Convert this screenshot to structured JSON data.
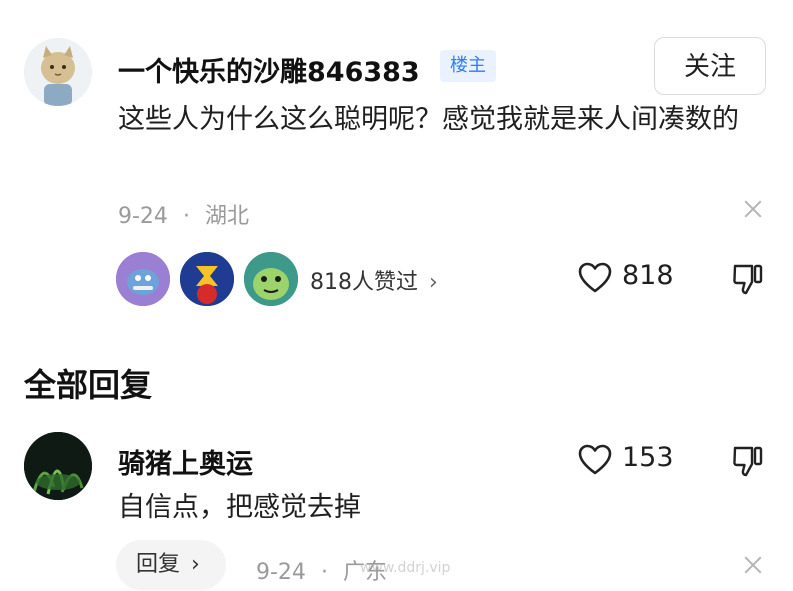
{
  "post": {
    "username": "一个快乐的沙雕846383",
    "badge": "楼主",
    "follow_label": "关注",
    "text": "这些人为什么这么聪明呢？感觉我就是来人间凑数的",
    "date": "9-24",
    "separator": "·",
    "location": "湖北",
    "likers_text": "818人赞过",
    "like_count": "818"
  },
  "section": {
    "title": "全部回复"
  },
  "reply": {
    "username": "骑猪上奥运",
    "text": "自信点，把感觉去掉",
    "like_count": "153",
    "reply_label": "回复",
    "date": "9-24",
    "separator": "·",
    "location": "广东"
  },
  "watermark": "www.ddrj.vip",
  "icons": {
    "close": "close-icon",
    "heart": "heart-icon",
    "dislike": "thumbs-down-icon",
    "chevron": "chevron-right-icon"
  },
  "colors": {
    "badge_text": "#2f7cf6",
    "badge_bg": "#eaf2ff",
    "meta_gray": "#9a9a9a"
  }
}
